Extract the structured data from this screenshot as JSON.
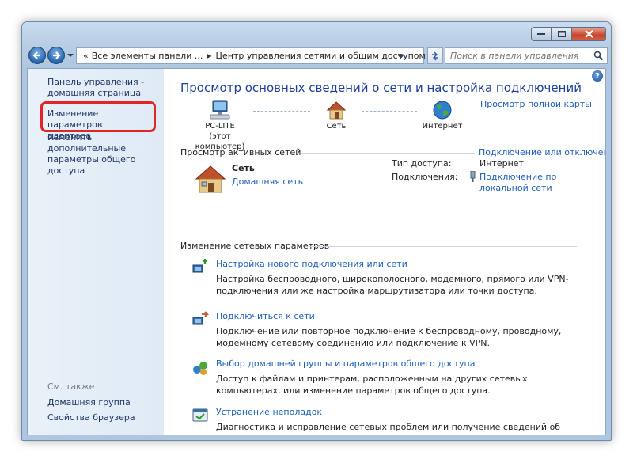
{
  "nav": {
    "address_crumbs": [
      "Все элементы панели ...",
      "Центр управления сетями и общим доступом"
    ],
    "address_prefix": "«",
    "search_placeholder": "Поиск в панели управления"
  },
  "sidebar": {
    "items": [
      {
        "label": "Панель управления - домашняя страница"
      },
      {
        "label": "Изменение параметров адаптера"
      },
      {
        "label": "Изменить дополнительные параметры общего доступа"
      }
    ],
    "see_also_header": "См. также",
    "see_also": [
      "Домашняя группа",
      "Свойства браузера"
    ]
  },
  "main": {
    "title": "Просмотр основных сведений о сети и настройка подключений",
    "full_map_link": "Просмотр полной карты",
    "network_map": [
      {
        "name": "PC-LITE",
        "sub": "(этот компьютер)"
      },
      {
        "name": "Сеть",
        "sub": ""
      },
      {
        "name": "Интернет",
        "sub": ""
      }
    ],
    "active_networks_header": "Просмотр активных сетей",
    "connect_disconnect_link": "Подключение или отключение",
    "active_network": {
      "name": "Сеть",
      "type_link": "Домашняя сеть",
      "access_type_label": "Тип доступа:",
      "access_type_value": "Интернет",
      "connections_label": "Подключения:",
      "connection_link": "Подключение по локальной сети"
    },
    "change_settings_header": "Изменение сетевых параметров",
    "tasks": [
      {
        "icon": "new-connection-icon",
        "title": "Настройка нового подключения или сети",
        "desc": "Настройка беспроводного, широкополосного, модемного, прямого или VPN-подключения или же настройка маршрутизатора или точки доступа."
      },
      {
        "icon": "connect-network-icon",
        "title": "Подключиться к сети",
        "desc": "Подключение или повторное подключение к беспроводному, проводному, модемному сетевому соединению или подключение к VPN."
      },
      {
        "icon": "homegroup-icon",
        "title": "Выбор домашней группы и параметров общего доступа",
        "desc": "Доступ к файлам и принтерам, расположенным на других сетевых компьютерах, или изменение параметров общего доступа."
      },
      {
        "icon": "troubleshoot-icon",
        "title": "Устранение неполадок",
        "desc": "Диагностика и исправление сетевых проблем или получение сведений об исправлении."
      }
    ]
  },
  "colors": {
    "link": "#1c5fb8",
    "title": "#1e3f9a",
    "highlight": "#e32525"
  }
}
